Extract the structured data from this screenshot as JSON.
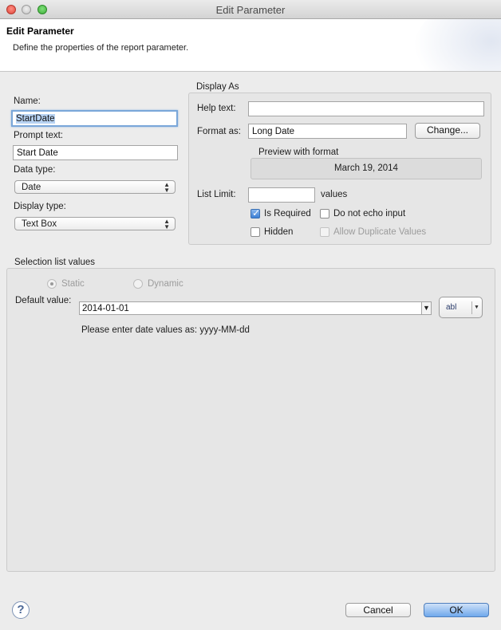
{
  "window": {
    "title": "Edit Parameter"
  },
  "header": {
    "title": "Edit Parameter",
    "description": "Define the properties of the report parameter."
  },
  "left": {
    "name_label": "Name:",
    "name_value": "StartDate",
    "prompt_label": "Prompt text:",
    "prompt_value": "Start Date",
    "data_type_label": "Data type:",
    "data_type_value": "Date",
    "display_type_label": "Display type:",
    "display_type_value": "Text Box"
  },
  "display_as": {
    "group_label": "Display As",
    "help_label": "Help text:",
    "help_value": "",
    "format_label": "Format as:",
    "format_value": "Long Date",
    "change_button": "Change...",
    "preview_label": "Preview with format",
    "preview_value": "March 19, 2014",
    "list_limit_label": "List Limit:",
    "list_limit_value": "",
    "values_suffix": "values",
    "is_required_label": "Is Required",
    "is_required_checked": true,
    "no_echo_label": "Do not echo input",
    "no_echo_checked": false,
    "hidden_label": "Hidden",
    "hidden_checked": false,
    "allow_dup_label": "Allow Duplicate Values",
    "allow_dup_checked": false
  },
  "selection": {
    "group_label": "Selection list values",
    "static_label": "Static",
    "dynamic_label": "Dynamic",
    "selected_radio": "Static",
    "default_label": "Default value:",
    "default_value": "2014-01-01",
    "expr_button_label": "abl",
    "hint": "Please enter date values as: yyyy-MM-dd"
  },
  "footer": {
    "help_icon": "?",
    "cancel_button": "Cancel",
    "ok_button": "OK"
  },
  "icons": {
    "help": "help-circle-icon",
    "dropdown": "chevron-down-icon",
    "updown": "updown-arrows-icon"
  }
}
